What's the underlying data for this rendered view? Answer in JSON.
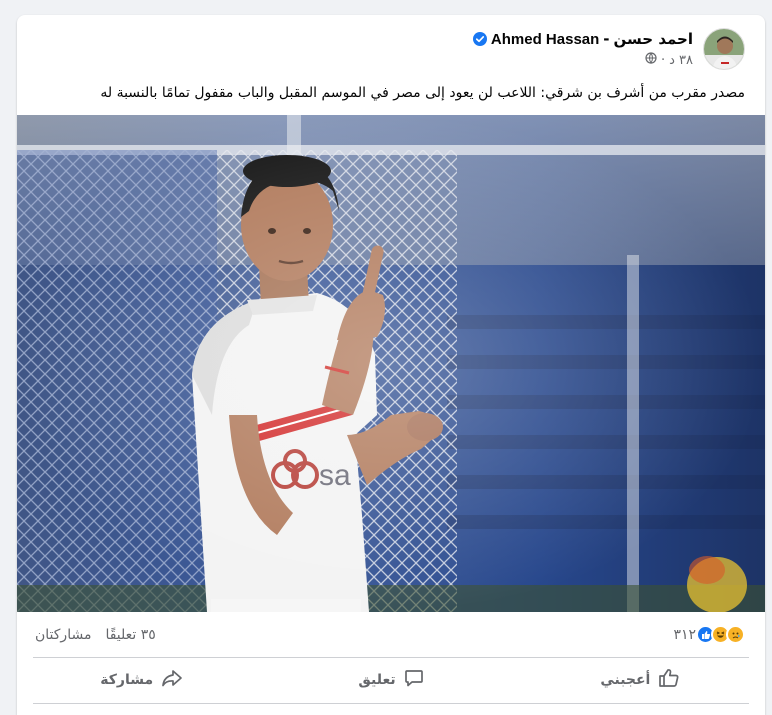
{
  "post": {
    "author_name": "احمد حسن",
    "separator": "-",
    "page_name": "Ahmed Hassan",
    "time": "٣٨ د",
    "privacy_icon": "globe-icon",
    "text": "مصدر مقرب من أشرف بن شرقي: اللاعب لن يعود إلى مصر في الموسم المقبل والباب مقفول تمامًا بالنسبة له"
  },
  "stats": {
    "reactions_count": "٣١٢",
    "comments": "٣٥ تعليقًا",
    "shares": "مشاركتان"
  },
  "actions": {
    "like_label": "أعجبني",
    "comment_label": "تعليق",
    "share_label": "مشاركة"
  },
  "colors": {
    "verified": "#1877f2",
    "like_reaction": "#1877f2",
    "haha_reaction": "#f7b125",
    "secondary_text": "#65676b"
  }
}
